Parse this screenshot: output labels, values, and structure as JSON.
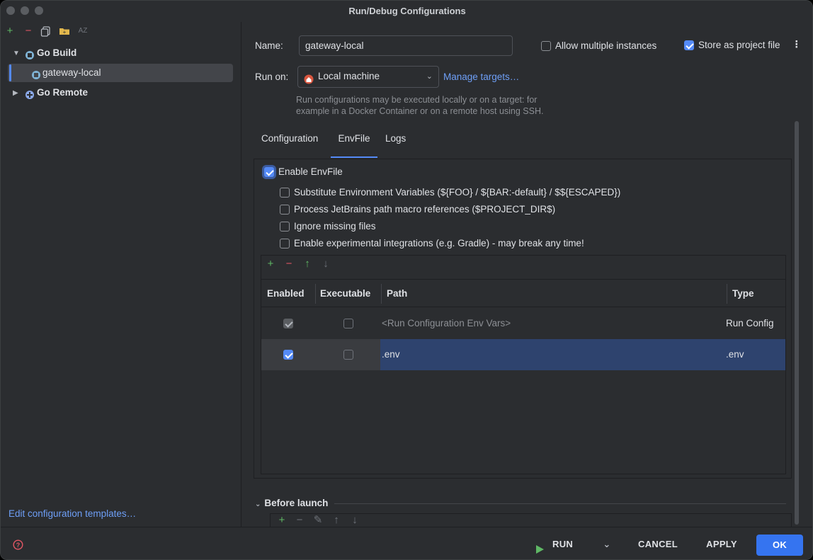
{
  "window": {
    "title": "Run/Debug Configurations"
  },
  "sidebar": {
    "toolbar": [
      "add-icon",
      "remove-icon",
      "copy-icon",
      "folder-icon",
      "sort-icon"
    ],
    "groups": [
      {
        "label": "Go Build",
        "expanded": true,
        "children": [
          {
            "label": "gateway-local",
            "selected": true
          }
        ]
      },
      {
        "label": "Go Remote",
        "expanded": false
      }
    ],
    "templates_link": "Edit configuration templates…"
  },
  "form": {
    "name_label": "Name:",
    "name_value": "gateway-local",
    "allow_multiple_label": "Allow multiple instances",
    "allow_multiple_checked": false,
    "store_project_label": "Store as project file",
    "store_project_checked": true,
    "run_on_label": "Run on:",
    "run_on_value": "Local machine",
    "manage_targets": "Manage targets…",
    "hint_line1": "Run configurations may be executed locally or on a target: for",
    "hint_line2": "example in a Docker Container or on a remote host using SSH."
  },
  "tabs": [
    {
      "label": "Configuration",
      "active": false
    },
    {
      "label": "EnvFile",
      "active": true
    },
    {
      "label": "Logs",
      "active": false
    }
  ],
  "envfile": {
    "enable_label": "Enable EnvFile",
    "enable_checked": true,
    "options": [
      {
        "label": "Substitute Environment Variables (${FOO} / ${BAR:-default} / $${ESCAPED})",
        "checked": false
      },
      {
        "label": "Process JetBrains path macro references ($PROJECT_DIR$)",
        "checked": false
      },
      {
        "label": "Ignore missing files",
        "checked": false
      },
      {
        "label": "Enable experimental integrations (e.g. Gradle) - may break any time!",
        "checked": false
      }
    ],
    "columns": {
      "enabled": "Enabled",
      "executable": "Executable",
      "path": "Path",
      "type": "Type"
    },
    "rows": [
      {
        "enabled": true,
        "executable": false,
        "path": "<Run Configuration Env Vars>",
        "type": "Run Config",
        "selected": false
      },
      {
        "enabled": true,
        "executable": false,
        "path": ".env",
        "type": ".env",
        "selected": true
      }
    ]
  },
  "before_launch": {
    "label": "Before launch"
  },
  "footer": {
    "run": "RUN",
    "cancel": "CANCEL",
    "apply": "APPLY",
    "ok": "OK"
  },
  "colors": {
    "accent": "#548af7",
    "primary_button": "#3574f0",
    "selection": "#2e436e",
    "run_icon": "#5fb865",
    "help_icon": "#e55765"
  }
}
